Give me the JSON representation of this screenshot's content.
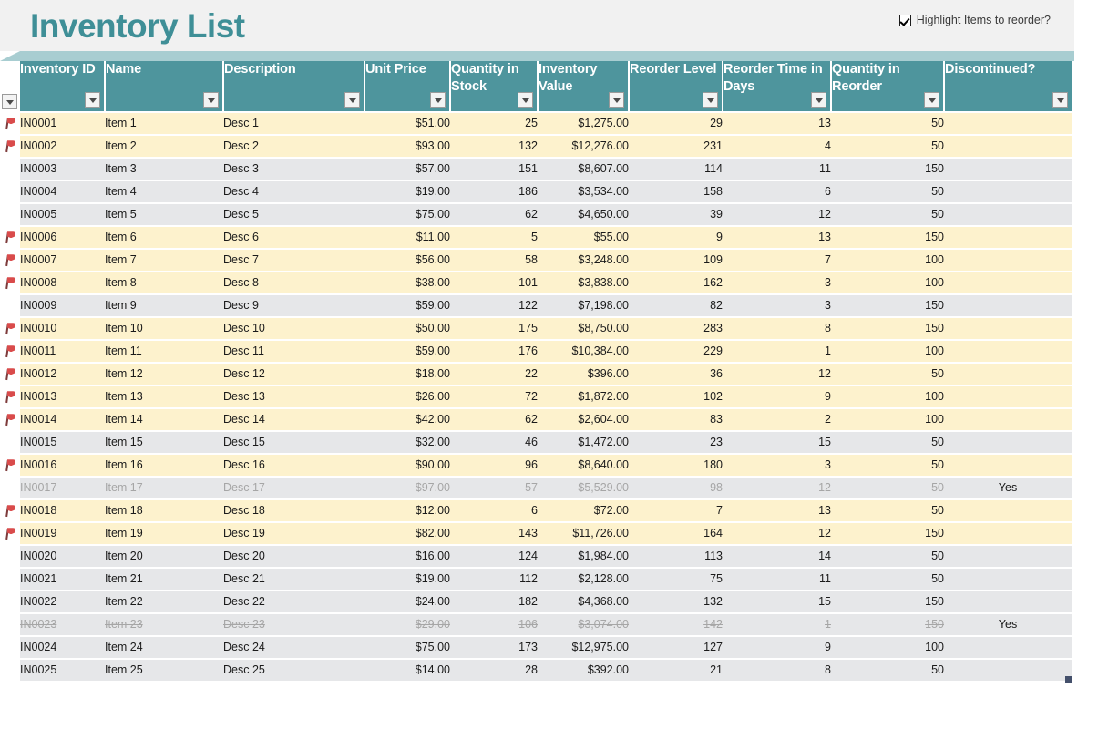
{
  "header": {
    "title": "Inventory List",
    "reorder_toggle_label": "Highlight Items to reorder?",
    "reorder_toggle_checked": "true"
  },
  "colors": {
    "accent_teal": "#4e959d",
    "title_teal": "#3f8f97",
    "strip_teal": "#a8cdd1",
    "highlight_row": "#fdf2cd",
    "plain_row": "#e6e7e9",
    "title_band": "#f1f1f1",
    "flag_red": "#d94b4b",
    "discontinued_text": "#a6a6a6"
  },
  "table": {
    "columns": [
      {
        "key": "flag",
        "label": "",
        "icon": "filter-icon"
      },
      {
        "key": "id",
        "label": "Inventory ID",
        "icon": "filter-icon"
      },
      {
        "key": "name",
        "label": "Name",
        "icon": "filter-icon"
      },
      {
        "key": "desc",
        "label": "Description",
        "icon": "filter-icon"
      },
      {
        "key": "price",
        "label": "Unit Price",
        "icon": "filter-icon"
      },
      {
        "key": "stock",
        "label": "Quantity in Stock",
        "icon": "filter-icon"
      },
      {
        "key": "value",
        "label": "Inventory Value",
        "icon": "filter-icon"
      },
      {
        "key": "level",
        "label": "Reorder Level",
        "icon": "filter-icon"
      },
      {
        "key": "days",
        "label": "Reorder Time in Days",
        "icon": "filter-icon"
      },
      {
        "key": "reorder",
        "label": "Quantity in Reorder",
        "icon": "filter-icon"
      },
      {
        "key": "disc",
        "label": "Discontinued?",
        "icon": "filter-icon"
      }
    ],
    "rows": [
      {
        "flag": "true",
        "id": "IN0001",
        "name": "Item 1",
        "desc": "Desc 1",
        "price": "$51.00",
        "stock": "25",
        "value": "$1,275.00",
        "level": "29",
        "days": "13",
        "reorder": "50",
        "disc": "",
        "highlight": "true",
        "discontinued": "false"
      },
      {
        "flag": "true",
        "id": "IN0002",
        "name": "Item 2",
        "desc": "Desc 2",
        "price": "$93.00",
        "stock": "132",
        "value": "$12,276.00",
        "level": "231",
        "days": "4",
        "reorder": "50",
        "disc": "",
        "highlight": "true",
        "discontinued": "false"
      },
      {
        "flag": "false",
        "id": "IN0003",
        "name": "Item 3",
        "desc": "Desc 3",
        "price": "$57.00",
        "stock": "151",
        "value": "$8,607.00",
        "level": "114",
        "days": "11",
        "reorder": "150",
        "disc": "",
        "highlight": "false",
        "discontinued": "false"
      },
      {
        "flag": "false",
        "id": "IN0004",
        "name": "Item 4",
        "desc": "Desc 4",
        "price": "$19.00",
        "stock": "186",
        "value": "$3,534.00",
        "level": "158",
        "days": "6",
        "reorder": "50",
        "disc": "",
        "highlight": "false",
        "discontinued": "false"
      },
      {
        "flag": "false",
        "id": "IN0005",
        "name": "Item 5",
        "desc": "Desc 5",
        "price": "$75.00",
        "stock": "62",
        "value": "$4,650.00",
        "level": "39",
        "days": "12",
        "reorder": "50",
        "disc": "",
        "highlight": "false",
        "discontinued": "false"
      },
      {
        "flag": "true",
        "id": "IN0006",
        "name": "Item 6",
        "desc": "Desc 6",
        "price": "$11.00",
        "stock": "5",
        "value": "$55.00",
        "level": "9",
        "days": "13",
        "reorder": "150",
        "disc": "",
        "highlight": "true",
        "discontinued": "false"
      },
      {
        "flag": "true",
        "id": "IN0007",
        "name": "Item 7",
        "desc": "Desc 7",
        "price": "$56.00",
        "stock": "58",
        "value": "$3,248.00",
        "level": "109",
        "days": "7",
        "reorder": "100",
        "disc": "",
        "highlight": "true",
        "discontinued": "false"
      },
      {
        "flag": "true",
        "id": "IN0008",
        "name": "Item 8",
        "desc": "Desc 8",
        "price": "$38.00",
        "stock": "101",
        "value": "$3,838.00",
        "level": "162",
        "days": "3",
        "reorder": "100",
        "disc": "",
        "highlight": "true",
        "discontinued": "false"
      },
      {
        "flag": "false",
        "id": "IN0009",
        "name": "Item 9",
        "desc": "Desc 9",
        "price": "$59.00",
        "stock": "122",
        "value": "$7,198.00",
        "level": "82",
        "days": "3",
        "reorder": "150",
        "disc": "",
        "highlight": "false",
        "discontinued": "false"
      },
      {
        "flag": "true",
        "id": "IN0010",
        "name": "Item 10",
        "desc": "Desc 10",
        "price": "$50.00",
        "stock": "175",
        "value": "$8,750.00",
        "level": "283",
        "days": "8",
        "reorder": "150",
        "disc": "",
        "highlight": "true",
        "discontinued": "false"
      },
      {
        "flag": "true",
        "id": "IN0011",
        "name": "Item 11",
        "desc": "Desc 11",
        "price": "$59.00",
        "stock": "176",
        "value": "$10,384.00",
        "level": "229",
        "days": "1",
        "reorder": "100",
        "disc": "",
        "highlight": "true",
        "discontinued": "false"
      },
      {
        "flag": "true",
        "id": "IN0012",
        "name": "Item 12",
        "desc": "Desc 12",
        "price": "$18.00",
        "stock": "22",
        "value": "$396.00",
        "level": "36",
        "days": "12",
        "reorder": "50",
        "disc": "",
        "highlight": "true",
        "discontinued": "false"
      },
      {
        "flag": "true",
        "id": "IN0013",
        "name": "Item 13",
        "desc": "Desc 13",
        "price": "$26.00",
        "stock": "72",
        "value": "$1,872.00",
        "level": "102",
        "days": "9",
        "reorder": "100",
        "disc": "",
        "highlight": "true",
        "discontinued": "false"
      },
      {
        "flag": "true",
        "id": "IN0014",
        "name": "Item 14",
        "desc": "Desc 14",
        "price": "$42.00",
        "stock": "62",
        "value": "$2,604.00",
        "level": "83",
        "days": "2",
        "reorder": "100",
        "disc": "",
        "highlight": "true",
        "discontinued": "false"
      },
      {
        "flag": "false",
        "id": "IN0015",
        "name": "Item 15",
        "desc": "Desc 15",
        "price": "$32.00",
        "stock": "46",
        "value": "$1,472.00",
        "level": "23",
        "days": "15",
        "reorder": "50",
        "disc": "",
        "highlight": "false",
        "discontinued": "false"
      },
      {
        "flag": "true",
        "id": "IN0016",
        "name": "Item 16",
        "desc": "Desc 16",
        "price": "$90.00",
        "stock": "96",
        "value": "$8,640.00",
        "level": "180",
        "days": "3",
        "reorder": "50",
        "disc": "",
        "highlight": "true",
        "discontinued": "false"
      },
      {
        "flag": "false",
        "id": "IN0017",
        "name": "Item 17",
        "desc": "Desc 17",
        "price": "$97.00",
        "stock": "57",
        "value": "$5,529.00",
        "level": "98",
        "days": "12",
        "reorder": "50",
        "disc": "Yes",
        "highlight": "false",
        "discontinued": "true"
      },
      {
        "flag": "true",
        "id": "IN0018",
        "name": "Item 18",
        "desc": "Desc 18",
        "price": "$12.00",
        "stock": "6",
        "value": "$72.00",
        "level": "7",
        "days": "13",
        "reorder": "50",
        "disc": "",
        "highlight": "true",
        "discontinued": "false"
      },
      {
        "flag": "true",
        "id": "IN0019",
        "name": "Item 19",
        "desc": "Desc 19",
        "price": "$82.00",
        "stock": "143",
        "value": "$11,726.00",
        "level": "164",
        "days": "12",
        "reorder": "150",
        "disc": "",
        "highlight": "true",
        "discontinued": "false"
      },
      {
        "flag": "false",
        "id": "IN0020",
        "name": "Item 20",
        "desc": "Desc 20",
        "price": "$16.00",
        "stock": "124",
        "value": "$1,984.00",
        "level": "113",
        "days": "14",
        "reorder": "50",
        "disc": "",
        "highlight": "false",
        "discontinued": "false"
      },
      {
        "flag": "false",
        "id": "IN0021",
        "name": "Item 21",
        "desc": "Desc 21",
        "price": "$19.00",
        "stock": "112",
        "value": "$2,128.00",
        "level": "75",
        "days": "11",
        "reorder": "50",
        "disc": "",
        "highlight": "false",
        "discontinued": "false"
      },
      {
        "flag": "false",
        "id": "IN0022",
        "name": "Item 22",
        "desc": "Desc 22",
        "price": "$24.00",
        "stock": "182",
        "value": "$4,368.00",
        "level": "132",
        "days": "15",
        "reorder": "150",
        "disc": "",
        "highlight": "false",
        "discontinued": "false"
      },
      {
        "flag": "false",
        "id": "IN0023",
        "name": "Item 23",
        "desc": "Desc 23",
        "price": "$29.00",
        "stock": "106",
        "value": "$3,074.00",
        "level": "142",
        "days": "1",
        "reorder": "150",
        "disc": "Yes",
        "highlight": "false",
        "discontinued": "true"
      },
      {
        "flag": "false",
        "id": "IN0024",
        "name": "Item 24",
        "desc": "Desc 24",
        "price": "$75.00",
        "stock": "173",
        "value": "$12,975.00",
        "level": "127",
        "days": "9",
        "reorder": "100",
        "disc": "",
        "highlight": "false",
        "discontinued": "false"
      },
      {
        "flag": "false",
        "id": "IN0025",
        "name": "Item 25",
        "desc": "Desc 25",
        "price": "$14.00",
        "stock": "28",
        "value": "$392.00",
        "level": "21",
        "days": "8",
        "reorder": "50",
        "disc": "",
        "highlight": "false",
        "discontinued": "false"
      }
    ]
  }
}
